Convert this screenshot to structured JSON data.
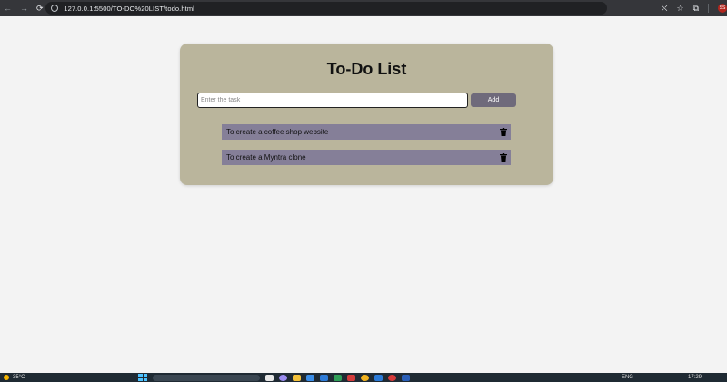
{
  "browser": {
    "url": "127.0.0.1:5500/TO-DO%20LIST/todo.html",
    "back_icon": "←",
    "forward_icon": "→",
    "reload_icon": "⟳",
    "info_icon": "i",
    "translate_icon": "⛌",
    "star_icon": "☆",
    "extensions_icon": "⧉",
    "profile_text": "SS"
  },
  "app": {
    "title": "To-Do List",
    "input": {
      "placeholder": "Enter the task",
      "value": ""
    },
    "add_button_label": "Add",
    "tasks": [
      {
        "label": "To create a coffee shop website"
      },
      {
        "label": "To create a Myntra clone"
      }
    ]
  },
  "taskbar": {
    "temperature": "35°C",
    "language": "ENG",
    "time": "17:29"
  },
  "colors": {
    "card_bg": "#bab59c",
    "task_bg": "#857f98",
    "button_bg": "#6f6a7b",
    "page_bg": "#f3f3f3"
  }
}
